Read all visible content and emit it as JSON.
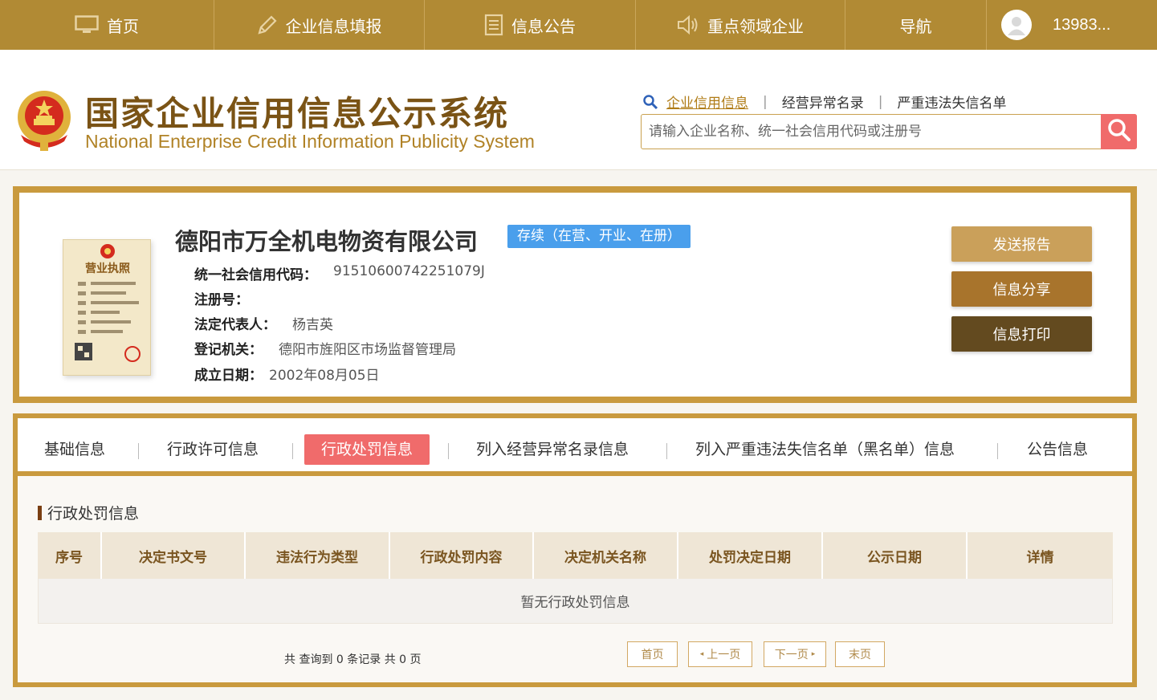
{
  "nav": {
    "home": "首页",
    "fill": "企业信息填报",
    "notice": "信息公告",
    "key_enterprise": "重点领域企业",
    "guide": "导航",
    "user": "13983..."
  },
  "header": {
    "title_cn": "国家企业信用信息公示系统",
    "title_en": "National Enterprise Credit Information Publicity System",
    "search_links": [
      "企业信用信息",
      "经营异常名录",
      "严重违法失信名单"
    ],
    "search_placeholder": "请输入企业名称、统一社会信用代码或注册号"
  },
  "company": {
    "name": "德阳市万全机电物资有限公司",
    "status": "存续（在营、开业、在册）",
    "fields": [
      {
        "label": "统一社会信用代码：",
        "value": "91510600742251079J"
      },
      {
        "label": "注册号：",
        "value": ""
      },
      {
        "label": "法定代表人：",
        "value": "杨吉英"
      },
      {
        "label": "登记机关：",
        "value": "德阳市旌阳区市场监督管理局"
      },
      {
        "label": "成立日期：",
        "value": "2002年08月05日"
      }
    ],
    "license_text": "营业执照",
    "actions": {
      "send": "发送报告",
      "share": "信息分享",
      "print": "信息打印"
    }
  },
  "tabs": {
    "items": [
      "基础信息",
      "行政许可信息",
      "行政处罚信息",
      "列入经营异常名录信息",
      "列入严重违法失信名单（黑名单）信息",
      "公告信息"
    ],
    "active_index": 2
  },
  "penalty": {
    "section_title": "行政处罚信息",
    "columns": [
      "序号",
      "决定书文号",
      "违法行为类型",
      "行政处罚内容",
      "决定机关名称",
      "处罚决定日期",
      "公示日期",
      "详情"
    ],
    "empty_text": "暂无行政处罚信息",
    "pager": {
      "summary": "共 查询到 0 条记录 共 0 页",
      "first": "首页",
      "prev": "上一页",
      "next": "下一页",
      "last": "末页"
    }
  },
  "colors": {
    "nav_bg": "#b18a34",
    "border_gold": "#c99a3e",
    "active_tab": "#f06b6b",
    "status_badge": "#4a9fec",
    "btn_send": "#caa05a",
    "btn_share": "#a8742c",
    "btn_print": "#634a1f"
  }
}
